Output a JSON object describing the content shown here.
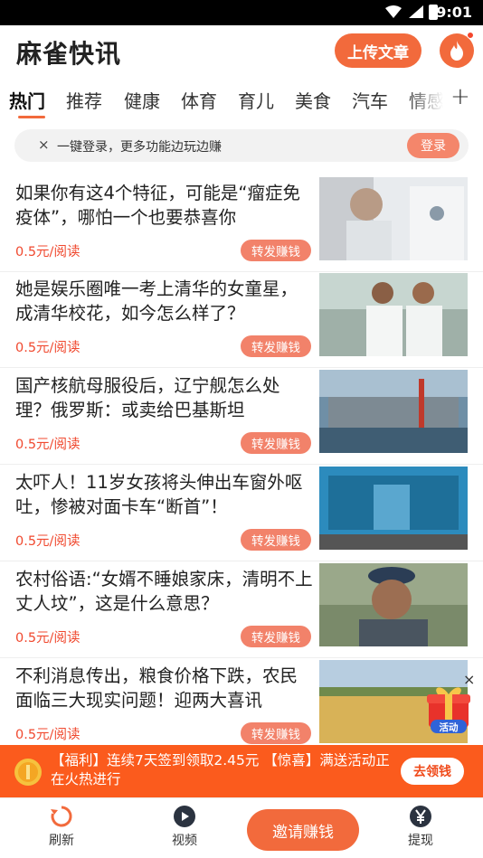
{
  "status_bar": {
    "time": "9:01",
    "icons": [
      "wifi-icon",
      "signal-icon",
      "battery-icon"
    ]
  },
  "header": {
    "app_title": "麻雀快讯",
    "upload_label": "上传文章",
    "fire_icon": "fire-icon"
  },
  "tabs": [
    {
      "label": "热门",
      "active": true
    },
    {
      "label": "推荐"
    },
    {
      "label": "健康"
    },
    {
      "label": "体育"
    },
    {
      "label": "育儿"
    },
    {
      "label": "美食"
    },
    {
      "label": "汽车"
    },
    {
      "label": "情感"
    }
  ],
  "tabs_more_label": "+",
  "login_banner": {
    "close_label": "×",
    "text": "一键登录，更多功能边玩边赚",
    "button_label": "登录"
  },
  "articles": [
    {
      "title": "如果你有这4个特征，可能是“瘤症免疫体”，哪怕一个也要恭喜你",
      "price": "0.5元/阅读",
      "share_label": "转发赚钱"
    },
    {
      "title": "她是娱乐圈唯一考上清华的女童星，成清华校花，如今怎么样了？",
      "price": "0.5元/阅读",
      "share_label": "转发赚钱"
    },
    {
      "title": "国产核航母服役后，辽宁舰怎么处理？俄罗斯：或卖给巴基斯坦",
      "price": "0.5元/阅读",
      "share_label": "转发赚钱"
    },
    {
      "title": "太吓人！11岁女孩将头伸出车窗外呕吐，惨被对面卡车“断首”！",
      "price": "0.5元/阅读",
      "share_label": "转发赚钱"
    },
    {
      "title": "农村俗语:“女婿不睡娘家床，清明不上丈人坟”，这是什么意思？",
      "price": "0.5元/阅读",
      "share_label": "转发赚钱"
    },
    {
      "title": "不利消息传出，粮食价格下跌，农民面临三大现实问题！迎两大喜讯",
      "price": "0.5元/阅读",
      "share_label": "转发赚钱"
    }
  ],
  "floating_gift": {
    "label": "活动",
    "close_label": "×"
  },
  "promo": {
    "text": "【福利】连续7天签到领取2.45元 【惊喜】满送活动正在火热进行",
    "button_label": "去领钱"
  },
  "bottom_nav": {
    "refresh_label": "刷新",
    "video_label": "视频",
    "invite_label": "邀请赚钱",
    "withdraw_label": "提现"
  },
  "colors": {
    "accent": "#f26a3c",
    "price": "#f0492f",
    "promo_bg": "#fb5b1d"
  }
}
